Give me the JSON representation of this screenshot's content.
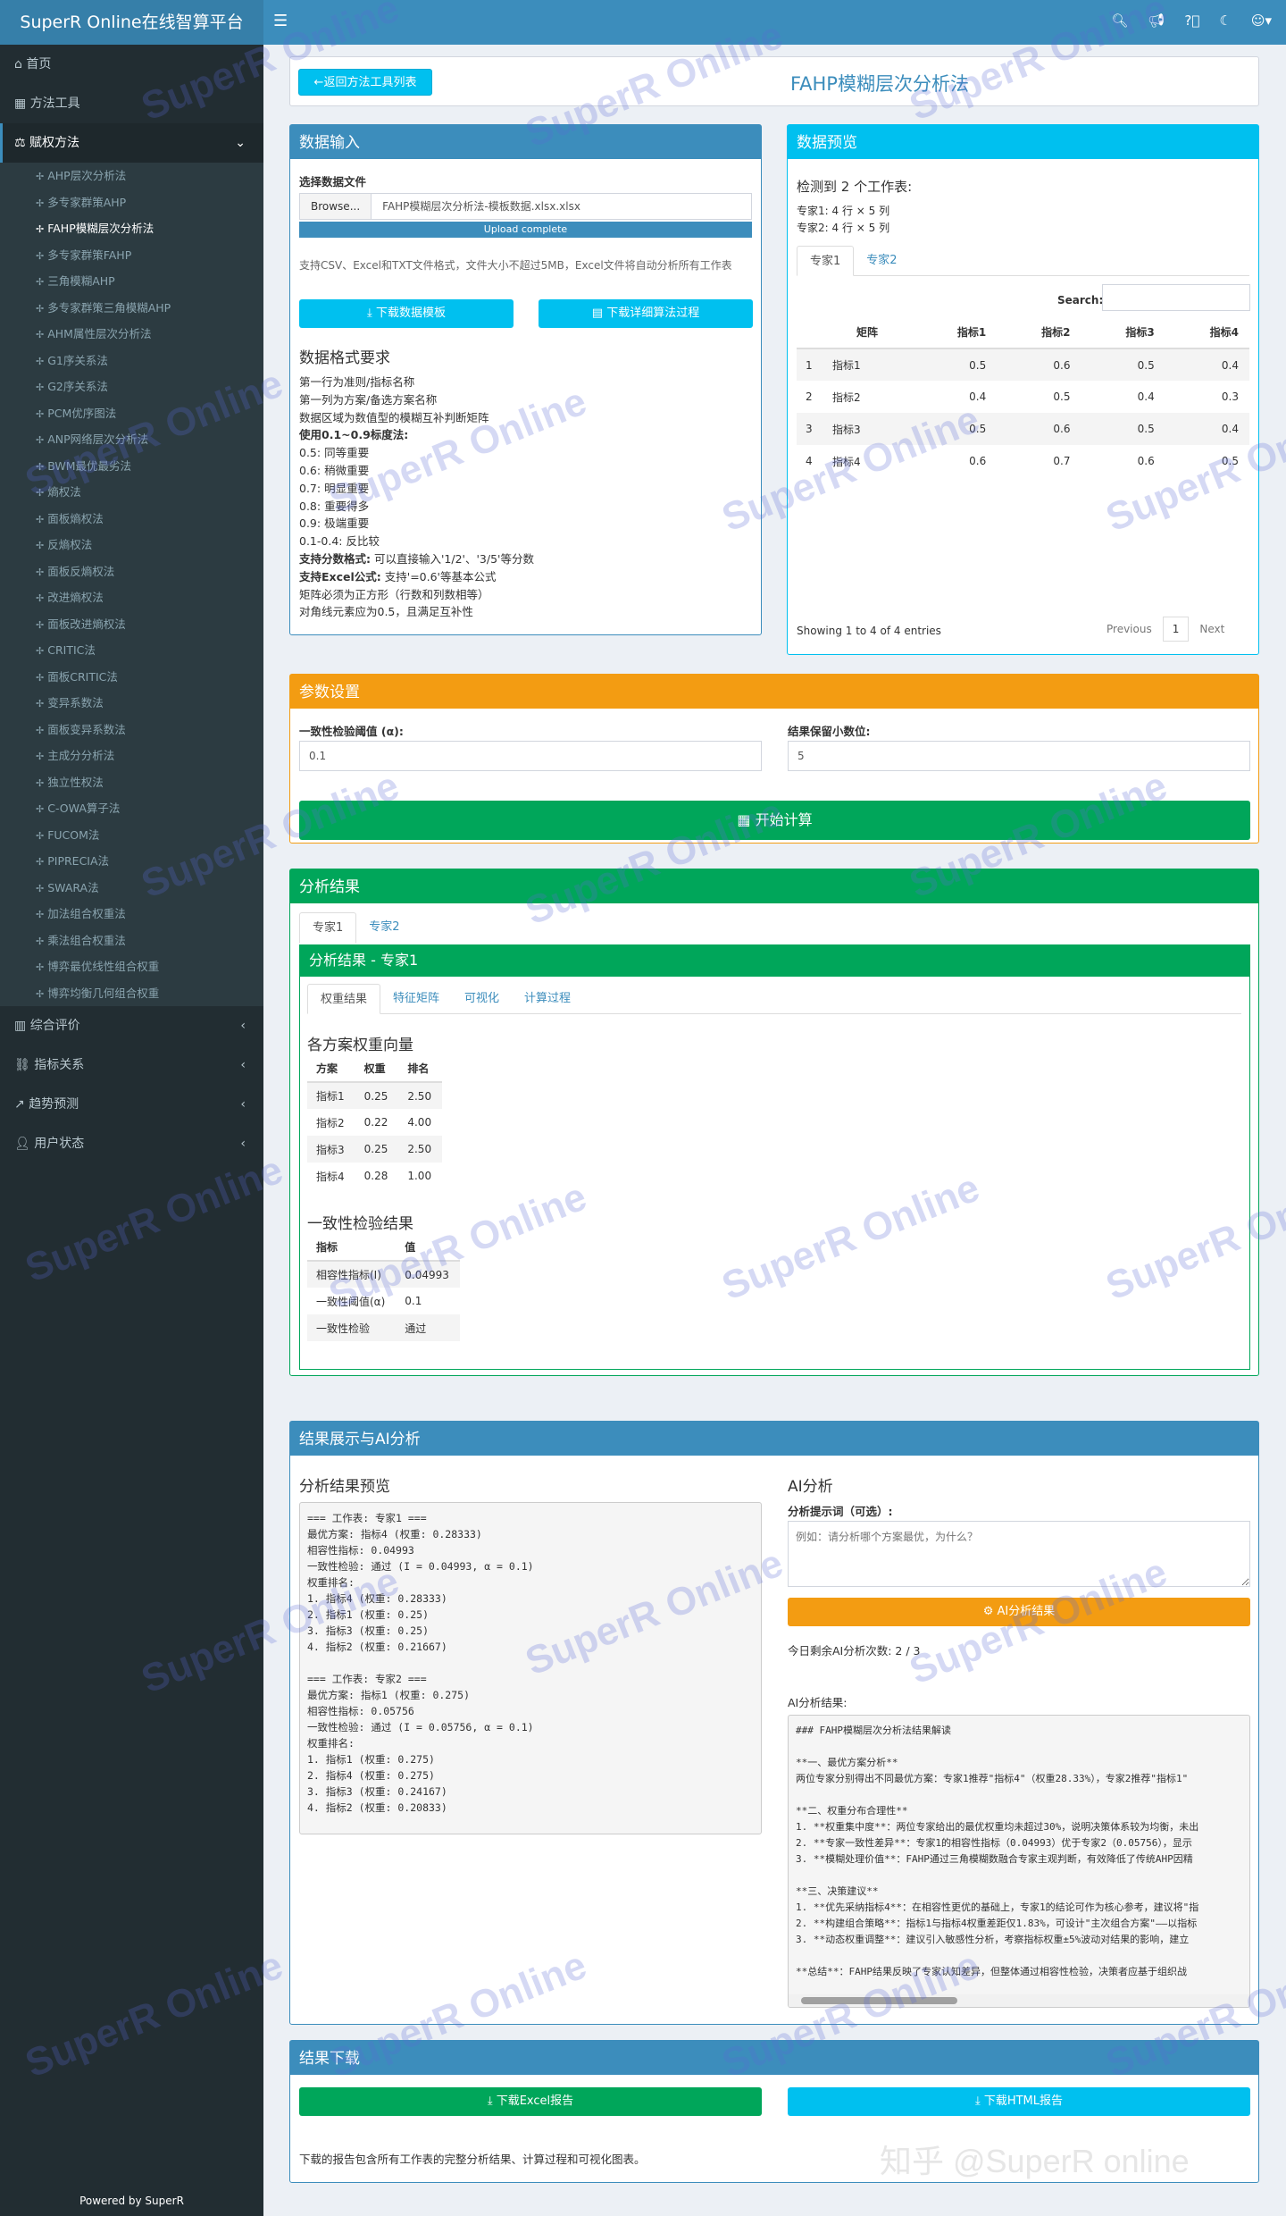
{
  "app": {
    "title": "SuperR Online在线智算平台",
    "powered": "Powered by SuperR",
    "watermark": "SuperR Online",
    "zhihu": "知乎 @SuperR online"
  },
  "sidebar": {
    "home": "首页",
    "tools": "方法工具",
    "weighting": "赋权方法",
    "sub": [
      "AHP层次分析法",
      "多专家群策AHP",
      "FAHP模糊层次分析法",
      "多专家群策FAHP",
      "三角模糊AHP",
      "多专家群策三角模糊AHP",
      "AHM属性层次分析法",
      "G1序关系法",
      "G2序关系法",
      "PCM优序图法",
      "ANP网络层次分析法",
      "BWM最优最劣法",
      "熵权法",
      "面板熵权法",
      "反熵权法",
      "面板反熵权法",
      "改进熵权法",
      "面板改进熵权法",
      "CRITIC法",
      "面板CRITIC法",
      "变异系数法",
      "面板变异系数法",
      "主成分分析法",
      "独立性权法",
      "C-OWA算子法",
      "FUCOM法",
      "PIPRECIA法",
      "SWARA法",
      "加法组合权重法",
      "乘法组合权重法",
      "博弈最优线性组合权重",
      "博弈均衡几何组合权重"
    ],
    "bottom": [
      "综合评价",
      "指标关系",
      "趋势预测",
      "用户状态"
    ]
  },
  "header": {
    "back": "返回方法工具列表",
    "title": "FAHP模糊层次分析法"
  },
  "input": {
    "title": "数据输入",
    "select_label": "选择数据文件",
    "browse": "Browse...",
    "filename": "FAHP模糊层次分析法-模板数据.xlsx.xlsx",
    "upload": "Upload complete",
    "hint": "支持CSV、Excel和TXT文件格式，文件大小不超过5MB，Excel文件将自动分析所有工作表",
    "btn_template": "下载数据模板",
    "btn_detail": "下载详细算法过程",
    "req_title": "数据格式要求",
    "req_lines": [
      "第一行为准则/指标名称",
      "第一列为方案/备选方案名称",
      "数据区域为数值型的模糊互补判断矩阵"
    ],
    "scale_title": "使用0.1~0.9标度法:",
    "scale_lines": [
      "0.5: 同等重要",
      "0.6: 稍微重要",
      "0.7: 明显重要",
      "0.8: 重要得多",
      "0.9: 极端重要",
      "0.1-0.4: 反比较"
    ],
    "frac_bold": "支持分数格式:",
    "frac_text": "可以直接输入'1/2'、'3/5'等分数",
    "excel_bold": "支持Excel公式:",
    "excel_text": "支持'=0.6'等基本公式",
    "req_last": [
      "矩阵必须为正方形（行数和列数相等）",
      "对角线元素应为0.5，且满足互补性"
    ]
  },
  "preview": {
    "title": "数据预览",
    "detected": "检测到 2 个工作表:",
    "sheet_lines": [
      "专家1: 4 行 × 5 列",
      "专家2: 4 行 × 5 列"
    ],
    "tabs": [
      "专家1",
      "专家2"
    ],
    "search": "Search:",
    "headers": [
      "",
      "矩阵",
      "指标1",
      "指标2",
      "指标3",
      "指标4"
    ],
    "rows": [
      [
        "1",
        "指标1",
        "0.5",
        "0.6",
        "0.5",
        "0.4"
      ],
      [
        "2",
        "指标2",
        "0.4",
        "0.5",
        "0.4",
        "0.3"
      ],
      [
        "3",
        "指标3",
        "0.5",
        "0.6",
        "0.5",
        "0.4"
      ],
      [
        "4",
        "指标4",
        "0.6",
        "0.7",
        "0.6",
        "0.5"
      ]
    ],
    "info": "Showing 1 to 4 of 4 entries",
    "prev": "Previous",
    "page": "1",
    "next": "Next"
  },
  "params": {
    "title": "参数设置",
    "label1": "一致性检验阈值 (α):",
    "val1": "0.1",
    "label2": "结果保留小数位:",
    "val2": "5",
    "btn": "开始计算"
  },
  "results": {
    "title": "分析结果",
    "tabs": [
      "专家1",
      "专家2"
    ],
    "sub_title": "分析结果 - 专家1",
    "inner_tabs": [
      "权重结果",
      "特征矩阵",
      "可视化",
      "计算过程"
    ],
    "weight_title": "各方案权重向量",
    "weight_headers": [
      "方案",
      "权重",
      "排名"
    ],
    "weight_rows": [
      [
        "指标1",
        "0.25",
        "2.50"
      ],
      [
        "指标2",
        "0.22",
        "4.00"
      ],
      [
        "指标3",
        "0.25",
        "2.50"
      ],
      [
        "指标4",
        "0.28",
        "1.00"
      ]
    ],
    "cons_title": "一致性检验结果",
    "cons_headers": [
      "指标",
      "值"
    ],
    "cons_rows": [
      [
        "相容性指标(I)",
        "0.04993"
      ],
      [
        "一致性阈值(α)",
        "0.1"
      ],
      [
        "一致性检验",
        "通过"
      ]
    ]
  },
  "ai": {
    "title": "结果展示与AI分析",
    "preview_title": "分析结果预览",
    "preview_text": "=== 工作表: 专家1 ===\n最优方案: 指标4 (权重: 0.28333)\n相容性指标: 0.04993\n一致性检验: 通过 (I = 0.04993, α = 0.1)\n权重排名:\n1. 指标4 (权重: 0.28333)\n2. 指标1 (权重: 0.25)\n3. 指标3 (权重: 0.25)\n4. 指标2 (权重: 0.21667)\n\n=== 工作表: 专家2 ===\n最优方案: 指标1 (权重: 0.275)\n相容性指标: 0.05756\n一致性检验: 通过 (I = 0.05756, α = 0.1)\n权重排名:\n1. 指标1 (权重: 0.275)\n2. 指标4 (权重: 0.275)\n3. 指标3 (权重: 0.24167)\n4. 指标2 (权重: 0.20833)",
    "ai_title": "AI分析",
    "prompt_label": "分析提示词（可选）:",
    "prompt_placeholder": "例如：请分析哪个方案最优，为什么？",
    "btn": "AI分析结果",
    "remaining": "今日剩余AI分析次数: 2 / 3",
    "result_label": "AI分析结果:",
    "result_text": "### FAHP模糊层次分析法结果解读\n\n**一、最优方案分析**\n两位专家分别得出不同最优方案：专家1推荐\"指标4\"（权重28.33%），专家2推荐\"指标1\"\n\n**二、权重分布合理性**\n1. **权重集中度**：两位专家给出的最优权重均未超过30%，说明决策体系较为均衡，未出\n2. **专家一致性差异**：专家1的相容性指标（0.04993）优于专家2（0.05756），显示\n3. **模糊处理价值**：FAHP通过三角模糊数融合专家主观判断，有效降低了传统AHP因精\n\n**三、决策建议**\n1. **优先采纳指标4**：在相容性更优的基础上，专家1的结论可作为核心参考，建议将\"指\n2. **构建组合策略**：指标1与指标4权重差距仅1.83%，可设计\"主次组合方案\"——以指标\n3. **动态权重调整**：建议引入敏感性分析，考察指标权重±5%波动对结果的影响，建立\n\n**总结**：FAHP结果反映了专家认知差异，但整体通过相容性检验，决策者应基于组织战"
  },
  "download": {
    "title": "结果下载",
    "excel": "下载Excel报告",
    "html": "下载HTML报告",
    "note": "下载的报告包含所有工作表的完整分析结果、计算过程和可视化图表。"
  },
  "colors": {
    "primary": "#3c8dbc",
    "info": "#00c0ef",
    "warning": "#f39c12",
    "success": "#00a65a",
    "sidebar": "#222d32"
  }
}
